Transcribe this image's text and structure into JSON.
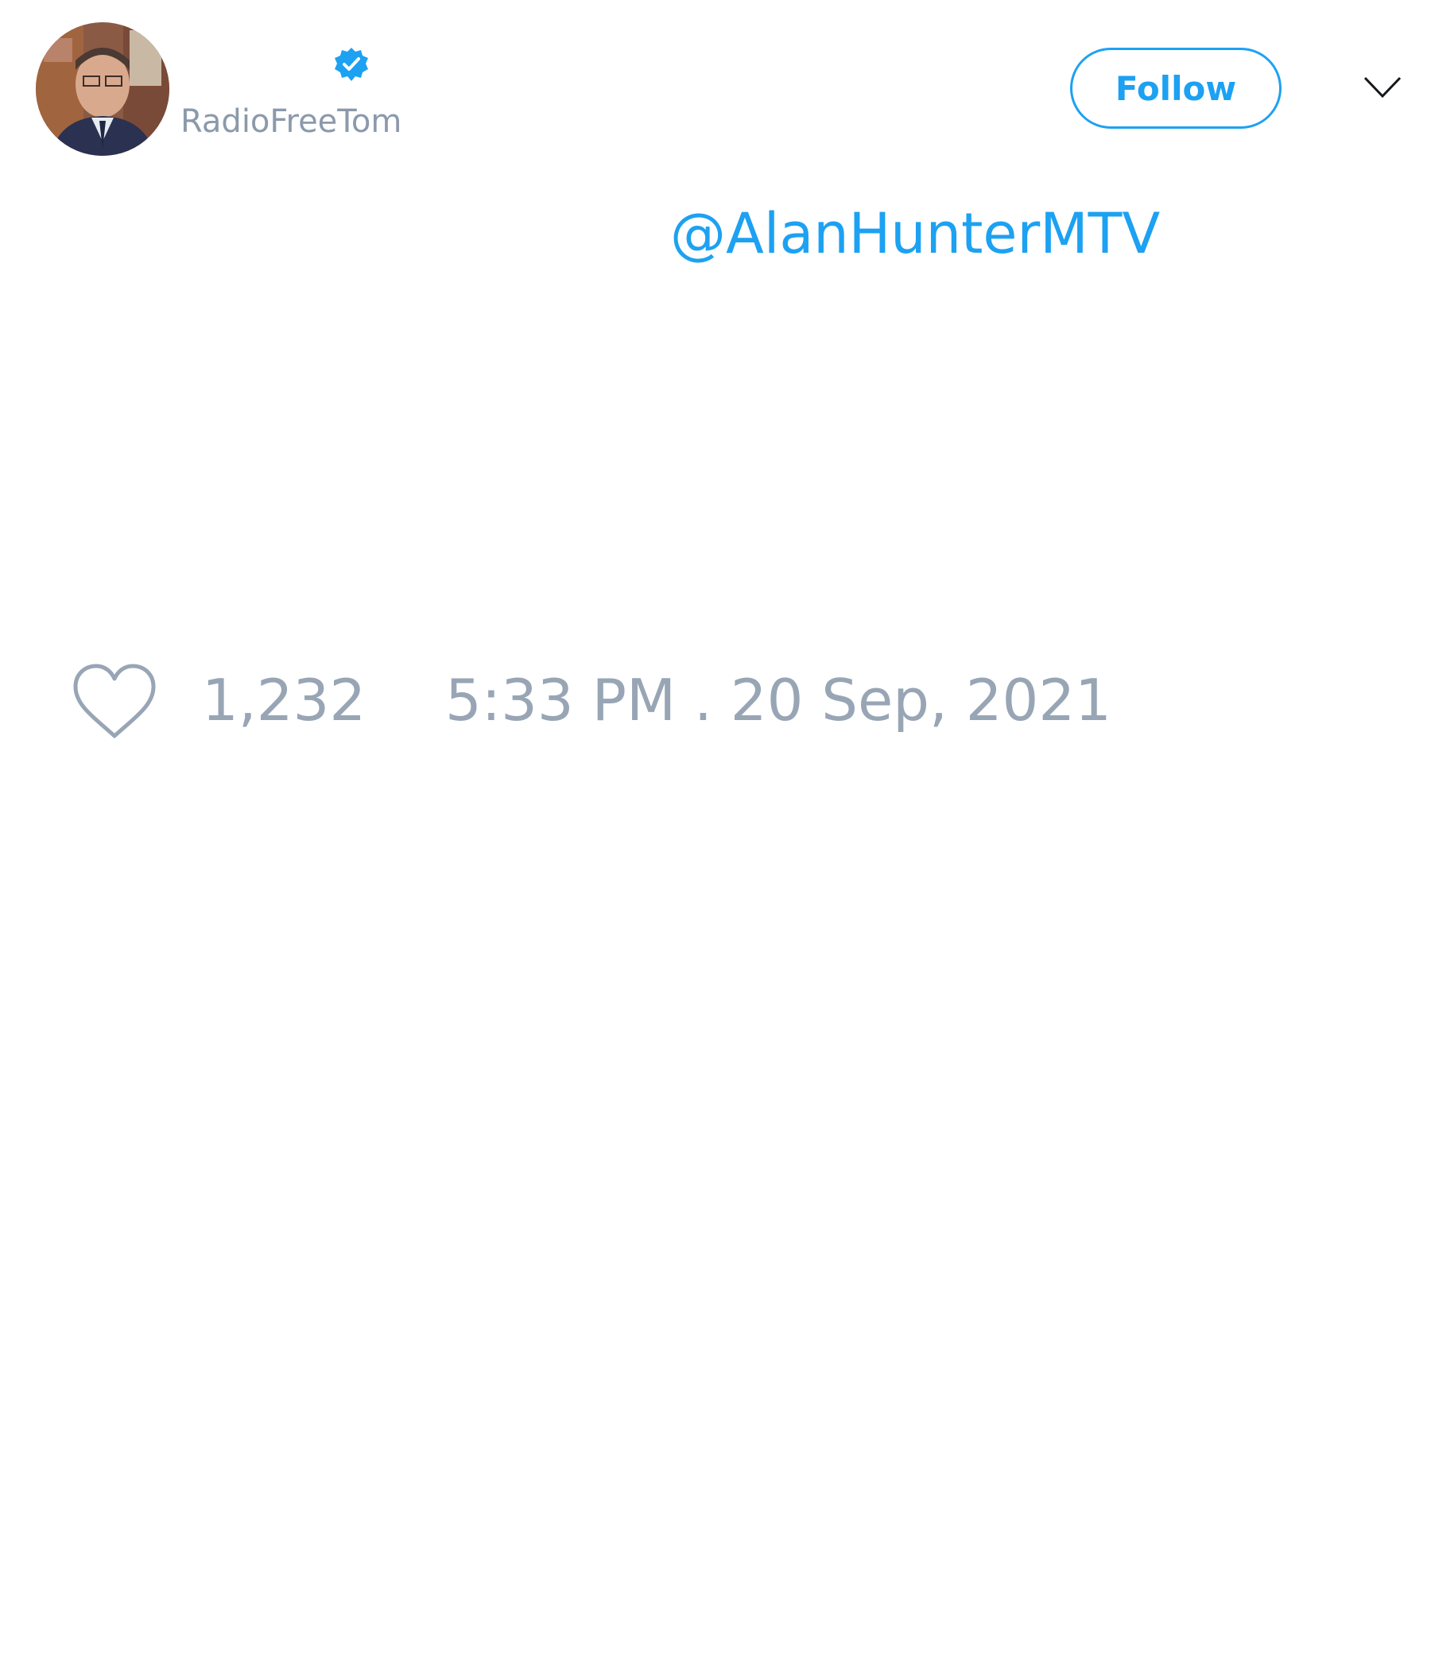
{
  "header": {
    "display_name": "",
    "handle": "RadioFreeTom",
    "verified": true,
    "follow_label": "Follow",
    "menu_icon": "chevron-down-icon"
  },
  "tweet": {
    "mention": "@AlanHunterMTV"
  },
  "footer": {
    "like_icon": "heart-outline-icon",
    "like_count": "1,232",
    "timestamp": "5:33 PM . 20 Sep, 2021"
  },
  "colors": {
    "accent": "#1da1f2",
    "muted": "#98a5b5",
    "background": "#ffffff"
  }
}
